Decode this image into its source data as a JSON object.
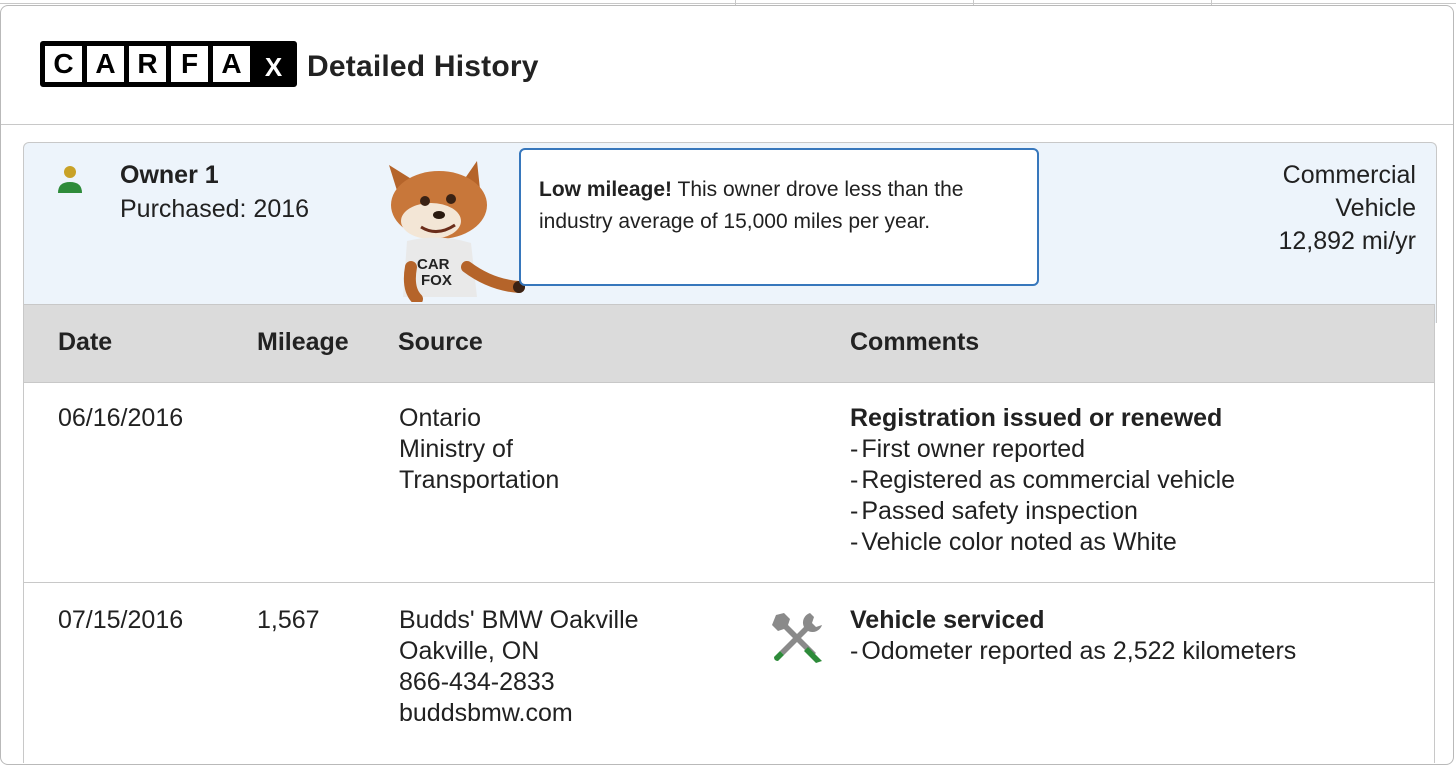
{
  "header": {
    "title": "Detailed History",
    "logo_letters": [
      "C",
      "A",
      "R",
      "F",
      "A",
      "X"
    ]
  },
  "owner": {
    "label": "Owner 1",
    "purchased": "Purchased: 2016",
    "callout_bold": "Low mileage!",
    "callout_text": " This owner drove less than the industry average of 15,000 miles per year.",
    "vehicle_type_line1": "Commercial",
    "vehicle_type_line2": "Vehicle",
    "mileage_rate": "12,892 mi/yr"
  },
  "table": {
    "columns": [
      "Date",
      "Mileage",
      "Source",
      "Comments"
    ],
    "rows": [
      {
        "date": "06/16/2016",
        "mileage": "",
        "source": [
          "Ontario",
          "Ministry of",
          "Transportation"
        ],
        "comment_title": "Registration issued or renewed",
        "comment_items": [
          "First owner reported",
          "Registered as commercial vehicle",
          "Passed safety inspection",
          "Vehicle color noted as White"
        ]
      },
      {
        "date": "07/15/2016",
        "mileage": "1,567",
        "source": [
          "Budds' BMW Oakville",
          "Oakville, ON",
          "866-434-2833",
          "buddsbmw.com"
        ],
        "comment_title": "Vehicle serviced",
        "comment_items": [
          "Odometer reported as 2,522 kilometers"
        ],
        "icon": "service-tools-icon"
      }
    ]
  },
  "colors": {
    "accent_blue": "#3777bc",
    "owner_bg": "#edf4fb",
    "header_bg": "#dbdbdb",
    "icon_green": "#2e8b3a",
    "icon_gold": "#c9a227"
  }
}
